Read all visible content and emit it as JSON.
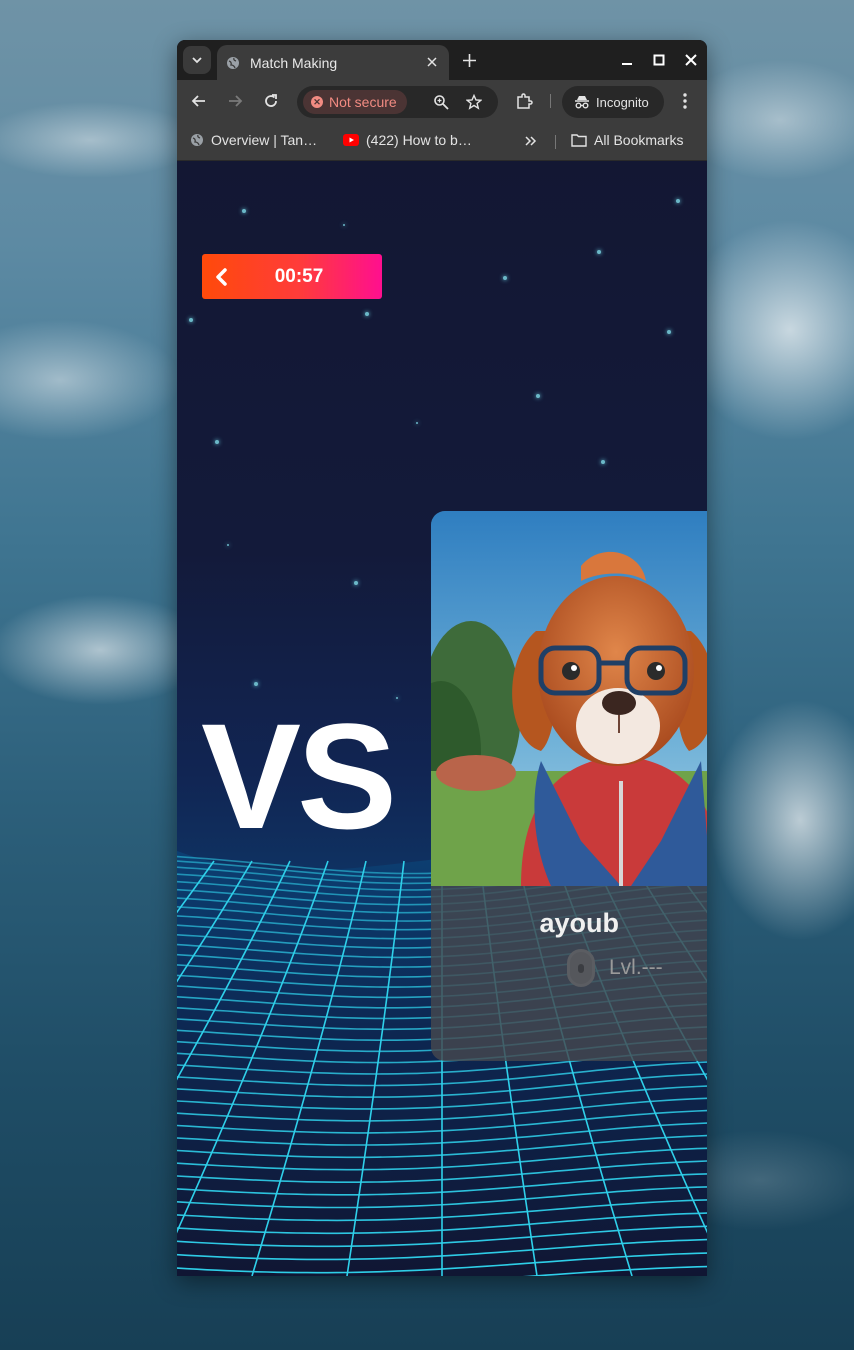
{
  "browser": {
    "tab_title": "Match Making",
    "security_label": "Not secure",
    "profile_label": "Incognito",
    "bookmarks": [
      {
        "label": "Overview | Tan…"
      },
      {
        "label": "(422) How to b…"
      }
    ],
    "all_bookmarks_label": "All Bookmarks"
  },
  "game": {
    "timer": "00:57",
    "vs_label": "VS",
    "opponent": {
      "name": "ayoub",
      "level": "Lvl.---"
    }
  },
  "colors": {
    "timer_gradient_start": "#ff4a0a",
    "timer_gradient_end": "#ff0f8f",
    "grid_line": "#2fd0ea",
    "background": "#131733"
  }
}
